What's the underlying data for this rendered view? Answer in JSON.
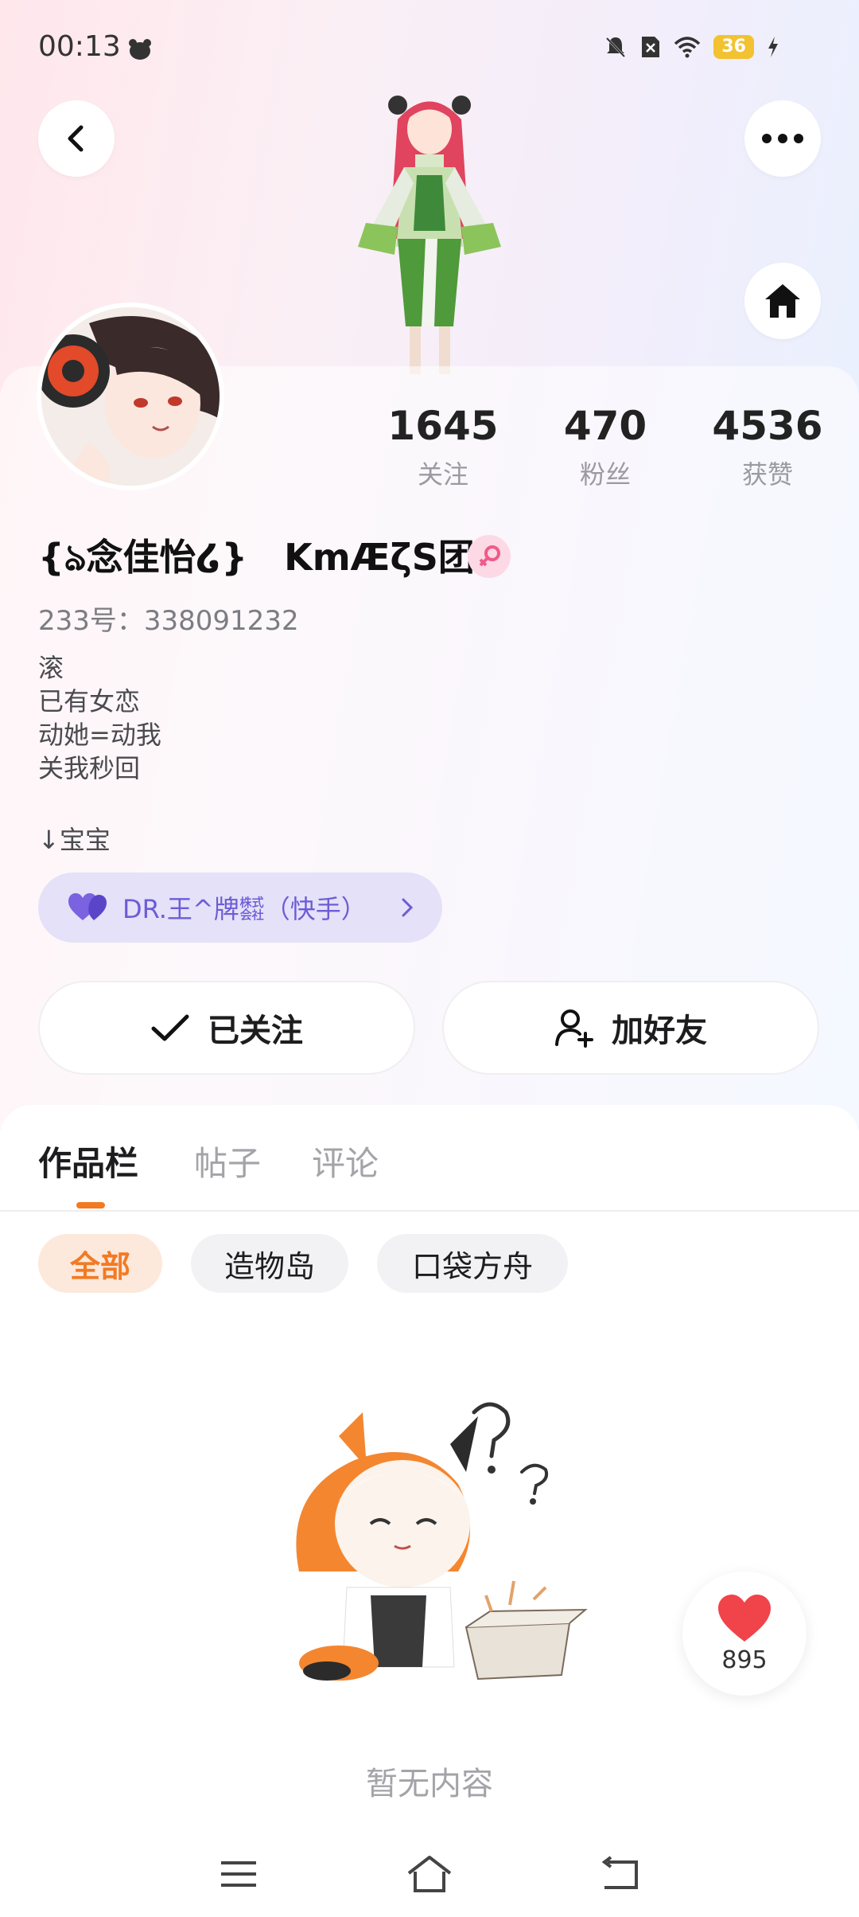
{
  "status_bar": {
    "time": "00:13",
    "battery": "36"
  },
  "profile": {
    "nickname": "{ঌ念佳怡໒}　KmÆζS团",
    "account_id": "233号：338091232",
    "bio": [
      "滚",
      "已有女恋",
      "动她=动我",
      "关我秒回"
    ],
    "sub_text": "↓宝宝",
    "group_chip": "DR.王^牌㍿（快手）"
  },
  "stats": [
    {
      "value": "1645",
      "label": "关注"
    },
    {
      "value": "470",
      "label": "粉丝"
    },
    {
      "value": "4536",
      "label": "获赞"
    }
  ],
  "actions": {
    "follow": "已关注",
    "add_friend": "加好友"
  },
  "tabs": [
    "作品栏",
    "帖子",
    "评论"
  ],
  "filters": [
    "全部",
    "造物岛",
    "口袋方舟"
  ],
  "empty_text": "暂无内容",
  "like_float": {
    "count": "895"
  },
  "colors": {
    "accent": "#f27a23",
    "group_chip_text": "#6d5cd6",
    "heart": "#f0434a"
  }
}
